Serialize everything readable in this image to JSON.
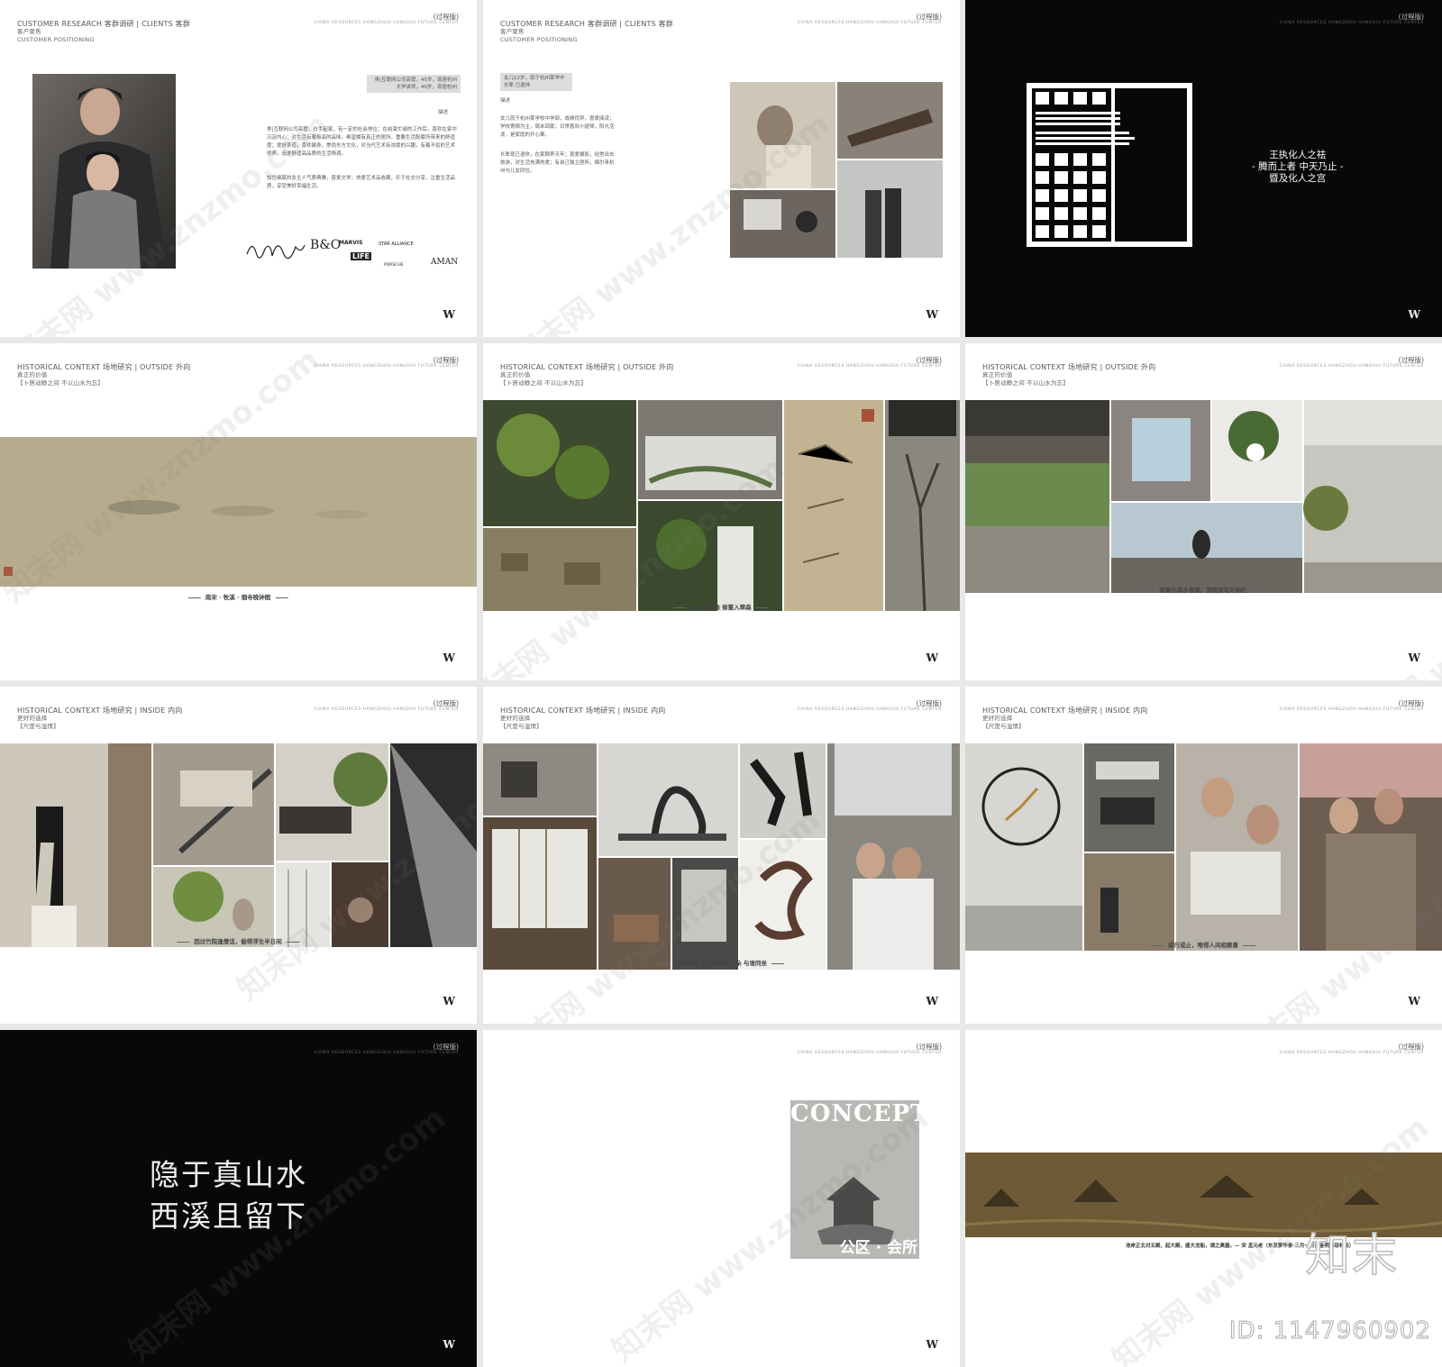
{
  "common": {
    "version": "(过程版)",
    "project": "CHINA RESOURCES HANGZHOU HANGHUI FUTURE CENTER",
    "logo": "W"
  },
  "slide1": {
    "header": [
      "CUSTOMER RESEARCH 客群调研 | CLIENTS 客群",
      "客户聚焦",
      "CUSTOMER POSITIONING"
    ],
    "tags": [
      "男|互联网公司高管，45岁，现居杭州",
      "大学讲师，40岁，现居杭州"
    ],
    "desc_title": "描述",
    "paragraphs": [
      "男|互联网公司高管，白手起家，有一定的社会地位；在结束忙碌的工作后，喜欢在家中沉淀内心；对生活有着极高的品味，希望拥有真正的居所，重要生活配套所带来的舒适度；爱好茶道，喜欢健身，崇尚东方文化，对当代艺术有浓厚的兴趣，有着不俗的艺术修养，追求舒适高品质的生活情调。",
      "知性细腻的女主人气质典雅，喜爱文学；热爱艺术品收藏，乐于社交分享，注重生活品质，享受美好幸福生活。"
    ],
    "brands": [
      "B&O",
      "MARVIS",
      "STAR ALLIANCE",
      "LIFE",
      "PORSCHE",
      "AMAN"
    ]
  },
  "slide2": {
    "header": [
      "CUSTOMER RESEARCH 客群调研 | CLIENTS 客群",
      "客户聚焦",
      "CUSTOMER POSITIONING"
    ],
    "tags": [
      "女儿12岁，就于杭州某学中",
      "长辈 已退休"
    ],
    "desc_title": "描述",
    "paragraphs": [
      "女儿就于杭州某学校中学部，成绩优异，喜爱阅读；学校寄宿为主，周末回家；日常喜欢小提琴，阳光活泼，是家庭的开心果。",
      "长辈现已退休，在家颐养天年；喜爱摄影，经常出去旅游，对生活充满热爱；有自己独立居所，偶尔来杭州与儿女同住。"
    ]
  },
  "slide3": {
    "poem": "王执化人之祛\n- 腾而上者 中天乃止 -\n暨及化人之宫"
  },
  "slide4": {
    "header": [
      "HISTORICAL CONTEXT 场地研究 | OUTSIDE 外向",
      "真正的价值",
      "【卜居动静之间 不以山水为忘】"
    ],
    "caption": "南宋 · 牧溪 · 烟寺晚钟图"
  },
  "slide5": {
    "header": [
      "HISTORICAL CONTEXT 场地研究 | OUTSIDE 外向",
      "真正的价值",
      "【卜居动静之间 不以山水为忘】"
    ],
    "caption": "十里清溪曲 修篁入翠森"
  },
  "slide6": {
    "header": [
      "HISTORICAL CONTEXT 场地研究 | OUTSIDE 外向",
      "真正的价值",
      "【卜居动静之间 不以山水为忘】"
    ],
    "caption": "观窗外溪水涨落，赏庭前花开始烂"
  },
  "slide7": {
    "header": [
      "HISTORICAL CONTEXT 场地研究 | INSIDE 内向",
      "更好的选择",
      "【尺度与温情】"
    ],
    "caption": "因过竹院逢僧话，偷得浮生半日闲"
  },
  "slide8": {
    "header": [
      "HISTORICAL CONTEXT 场地研究 | INSIDE 内向",
      "更好的选择",
      "【尺度与温情】"
    ],
    "caption": "闲倚胡床 庾公楼外峰千朵 与谁同坐"
  },
  "slide9": {
    "header": [
      "HISTORICAL CONTEXT 场地研究 | INSIDE 内向",
      "更好的选择",
      "【尺度与温情】"
    ],
    "caption": "或行或止，唯得人间相聚喜"
  },
  "slide10": {
    "text": "隐于真山水\n西溪且留下"
  },
  "slide11": {
    "concept": "CONCEPT",
    "sub": "公区 · 会所"
  },
  "slide12": {
    "caption": "池岸正北对五殿，起大殿，盛大龙船，谓之奥屋。— 宋 孟元老（东京梦华录·三月一日开金明池琼林苑）"
  },
  "watermark": {
    "text": "知末网 www.znzmo.com",
    "logo": "知末",
    "id": "ID: 1147960902"
  }
}
